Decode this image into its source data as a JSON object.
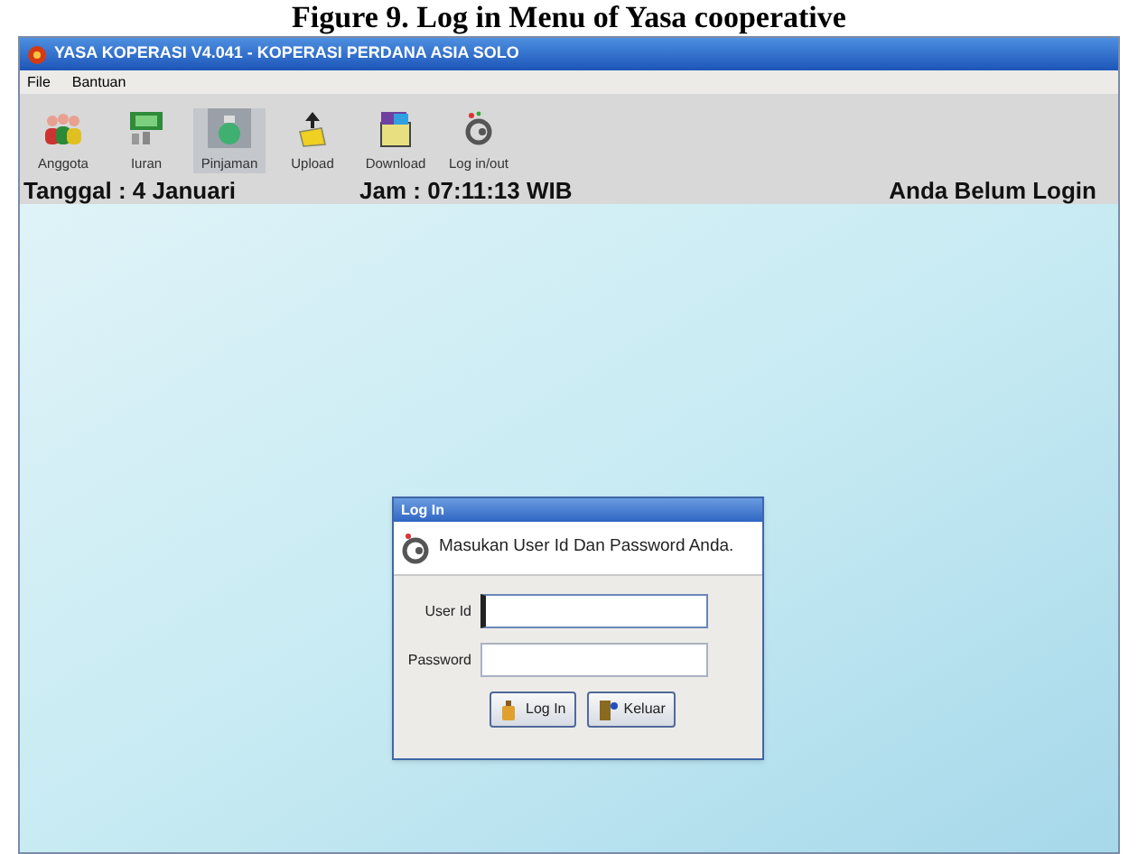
{
  "caption": "Figure 9. Log in Menu of Yasa cooperative",
  "window": {
    "title": "YASA KOPERASI V4.041 - KOPERASI PERDANA ASIA SOLO"
  },
  "menu": [
    "File",
    "Bantuan"
  ],
  "toolbar": [
    {
      "kind": "people",
      "label": "Anggota",
      "selected": false
    },
    {
      "kind": "money",
      "label": "Iuran",
      "selected": false
    },
    {
      "kind": "jar",
      "label": "Pinjaman",
      "selected": true
    },
    {
      "kind": "upload",
      "label": "Upload",
      "selected": false
    },
    {
      "kind": "download",
      "label": "Download",
      "selected": false
    },
    {
      "kind": "key",
      "label": "Log in/out",
      "selected": false
    }
  ],
  "status": {
    "date": "Tanggal : 4 Januari",
    "time": "Jam : 07:11:13 WIB",
    "login": "Anda Belum Login"
  },
  "dialog": {
    "title": "Log In",
    "message": "Masukan User Id Dan Password Anda.",
    "fields": [
      {
        "label": "User Id",
        "focused": true
      },
      {
        "label": "Password",
        "focused": false
      }
    ],
    "buttons": [
      {
        "kind": "login",
        "label": "Log In"
      },
      {
        "kind": "exit",
        "label": "Keluar"
      }
    ]
  }
}
